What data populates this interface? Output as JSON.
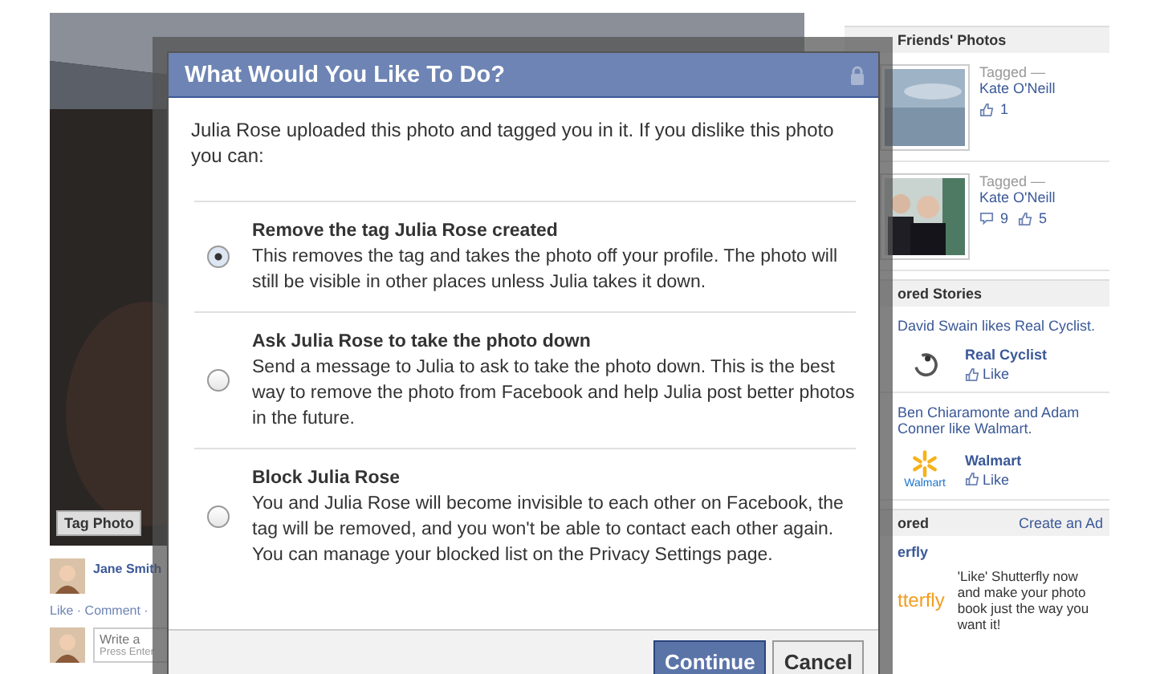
{
  "photo": {
    "tag_button": "Tag Photo"
  },
  "post": {
    "author": "Jane Smith",
    "actions": "Like · Comment ·",
    "comment": {
      "placeholder": "Write a",
      "hint": "Press Enter"
    }
  },
  "sidebar": {
    "friends_photos": {
      "title": "Friends' Photos",
      "items": [
        {
          "tagged": "Tagged —",
          "person": "Kate O'Neill",
          "likes": "1"
        },
        {
          "tagged": "Tagged —",
          "person": "Kate O'Neill",
          "comments": "9",
          "likes": "5"
        }
      ]
    },
    "sponsored_stories": {
      "title": "ored Stories",
      "items": [
        {
          "story": "David Swain likes Real Cyclist.",
          "page": "Real Cyclist",
          "like": "Like"
        },
        {
          "story": "Ben Chiaramonte and Adam Conner like Walmart.",
          "logo_text": "Walmart",
          "page": "Walmart",
          "like": "Like"
        }
      ]
    },
    "ads": {
      "title": "ored",
      "link": "Create an Ad",
      "ad_title": "erfly",
      "logo_text": "tterfly",
      "text": "'Like' Shutterfly now and make your photo book just the way you want it!"
    }
  },
  "dialog": {
    "title": "What Would You Like To Do?",
    "intro": "Julia Rose uploaded this photo and tagged you in it. If you dislike this photo you can:",
    "options": [
      {
        "title": "Remove the tag Julia Rose created",
        "text": "This removes the tag and takes the photo off your profile. The photo will still be visible in other places unless Julia takes it down.",
        "selected": true
      },
      {
        "title": "Ask Julia Rose to take the photo down",
        "text": "Send a message to Julia to ask to take the photo down. This is the best way to remove the photo from Facebook and help Julia  post better photos in the future.",
        "selected": false
      },
      {
        "title": "Block Julia Rose",
        "text": "You and Julia Rose will become invisible to each other on Facebook, the tag will be removed, and you won't be able to contact each other again. You can manage your blocked list on the Privacy Settings page.",
        "selected": false
      }
    ],
    "buttons": [
      {
        "label": "Continue",
        "kind": "primary"
      },
      {
        "label": "Cancel",
        "kind": "secondary"
      }
    ]
  }
}
